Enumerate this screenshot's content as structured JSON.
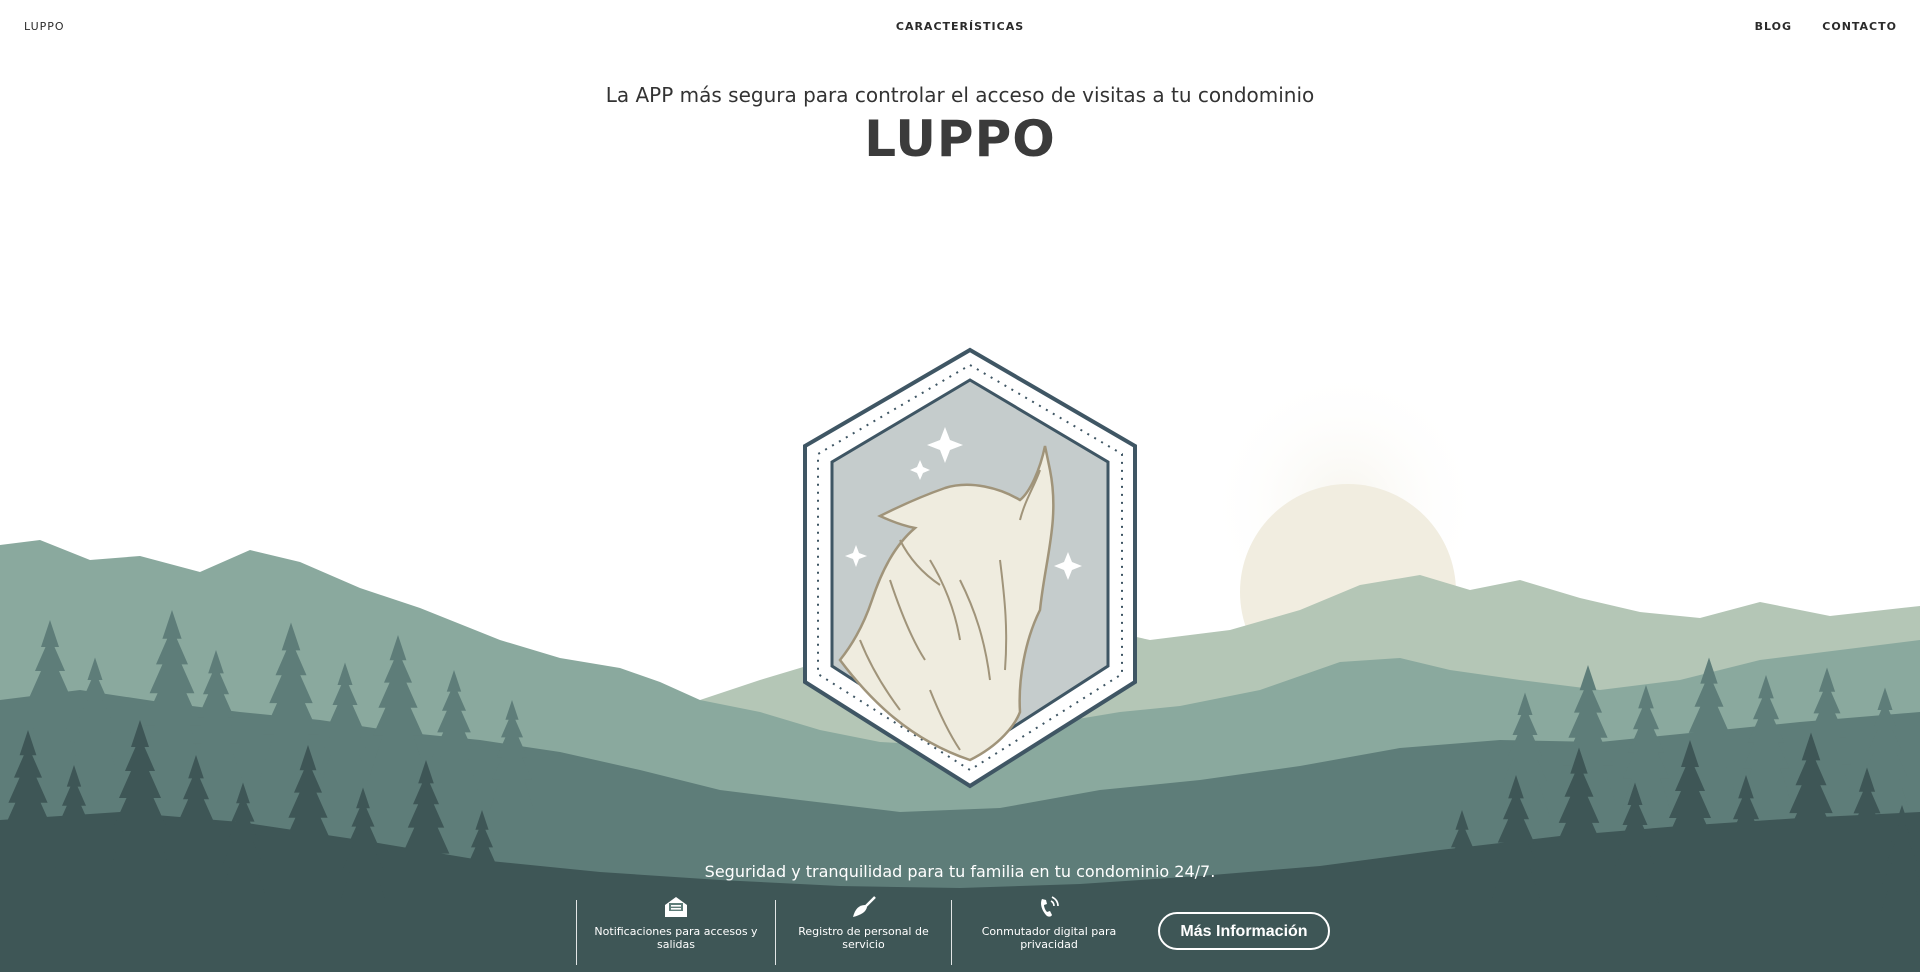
{
  "nav": {
    "brand": "LUPPO",
    "center": "CARACTERÍSTICAS",
    "blog": "BLOG",
    "contact": "CONTACTO"
  },
  "hero": {
    "subtitle": "La APP más segura para controlar el acceso de visitas a tu condominio",
    "title": "LUPPO"
  },
  "footer": {
    "tagline": "Seguridad y tranquilidad para tu familia en tu condominio 24/7.",
    "features": [
      {
        "icon": "envelope-open-icon",
        "label": "Notificaciones para accesos y salidas"
      },
      {
        "icon": "broom-icon",
        "label": "Registro de personal de servicio"
      },
      {
        "icon": "phone-ringing-icon",
        "label": "Conmutador digital para privacidad"
      }
    ],
    "cta": "Más Información"
  },
  "colors": {
    "mountain_light": "#b4c6b6",
    "mountain_mid": "#8aa99e",
    "forest_far": "#5e7d79",
    "forest_near": "#3e5656",
    "moon": "#f1ede0",
    "badge_stroke": "#3f5664",
    "badge_fill": "#c5cccc",
    "wolf_fill": "#efecdf"
  }
}
